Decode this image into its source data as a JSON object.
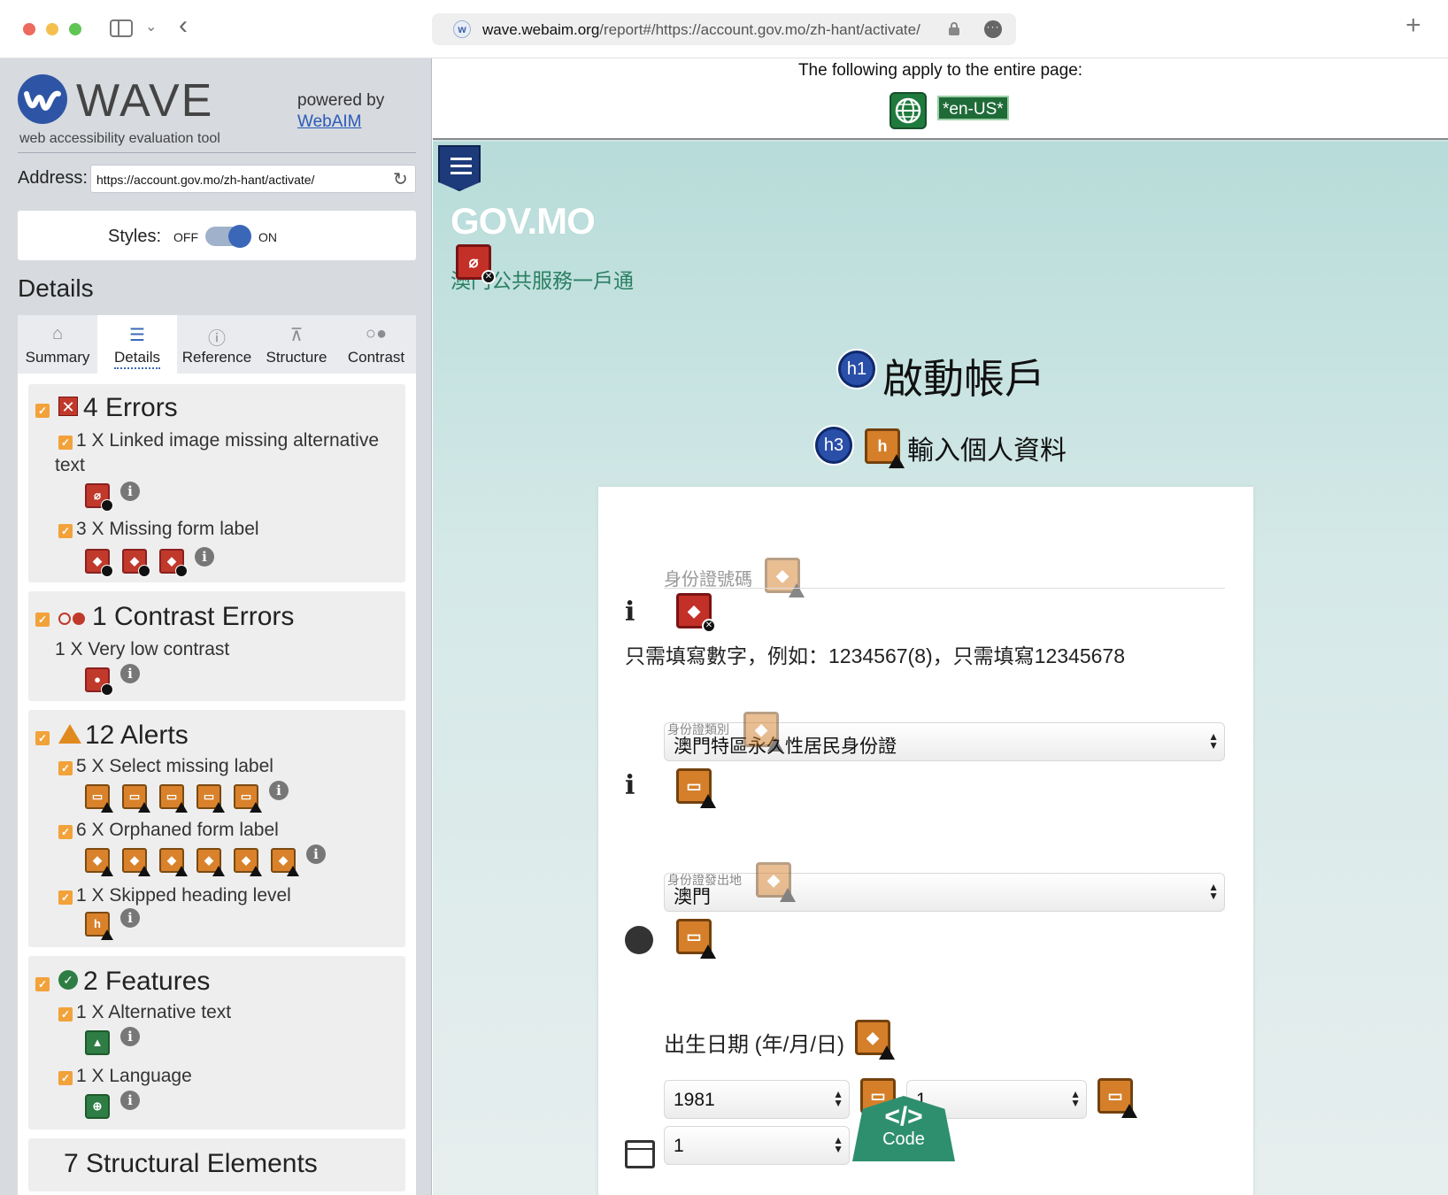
{
  "browser": {
    "url_host": "wave.webaim.org",
    "url_path": "/report#/https://account.gov.mo/zh-hant/activate/"
  },
  "wave": {
    "title": "WAVE",
    "subtitle": "web accessibility evaluation tool",
    "powered_by": "powered by",
    "webaim_link": "WebAIM",
    "address_label": "Address:",
    "address_value": "https://account.gov.mo/zh-hant/activate/",
    "styles_label": "Styles:",
    "styles_off": "OFF",
    "styles_on": "ON",
    "styles_enabled": true,
    "details_heading": "Details",
    "tabs": [
      {
        "label": "Summary",
        "icon": "home-icon"
      },
      {
        "label": "Details",
        "icon": "list-icon",
        "active": true
      },
      {
        "label": "Reference",
        "icon": "info-icon"
      },
      {
        "label": "Structure",
        "icon": "sitemap-icon"
      },
      {
        "label": "Contrast",
        "icon": "contrast-icon"
      }
    ],
    "sections": {
      "errors": {
        "title": "4 Errors",
        "items": [
          {
            "label": "1 X Linked image missing alternative text",
            "line1": "1 X Linked image missing alternative",
            "line2": "text",
            "count": 1
          },
          {
            "label": "3 X Missing form label",
            "count": 3
          }
        ]
      },
      "contrast": {
        "title": "1 Contrast Errors",
        "items": [
          {
            "label": "1 X Very low contrast",
            "count": 1
          }
        ]
      },
      "alerts": {
        "title": "12 Alerts",
        "items": [
          {
            "label": "5 X Select missing label",
            "count": 5
          },
          {
            "label": "6 X Orphaned form label",
            "count": 6
          },
          {
            "label": "1 X Skipped heading level",
            "count": 1
          }
        ]
      },
      "features": {
        "title": "2 Features",
        "items": [
          {
            "label": "1 X Alternative text",
            "count": 1
          },
          {
            "label": "1 X Language",
            "count": 1
          }
        ]
      },
      "structural": {
        "title": "7 Structural Elements"
      }
    }
  },
  "page": {
    "apply_text": "The following apply to the entire page:",
    "lang_tag": "*en-US*",
    "gov_logo": "GOV.MO",
    "gov_tagline": "澳門公共服務一戶通",
    "h1_badge": "h1",
    "h1_text": "啟動帳戶",
    "h3_badge": "h3",
    "h3_text": "輸入個人資料",
    "id_number_label": "身份證號碼",
    "id_hint": "只需填寫數字，例如：1234567(8)，只需填寫12345678",
    "id_type_label": "身份證類別",
    "id_type_value": "澳門特區永久性居民身份證",
    "id_place_label": "身份證發出地",
    "id_place_value": "澳門",
    "dob_label": "出生日期 (年/月/日)",
    "dob_year": "1981",
    "dob_month": "1",
    "dob_day": "1",
    "code_label": "Code"
  },
  "colors": {
    "error": "#c23028",
    "alert": "#d57f2a",
    "feature": "#2e7d45",
    "wave_blue": "#2e55a5",
    "sidebar_bg": "#d7dadf"
  }
}
